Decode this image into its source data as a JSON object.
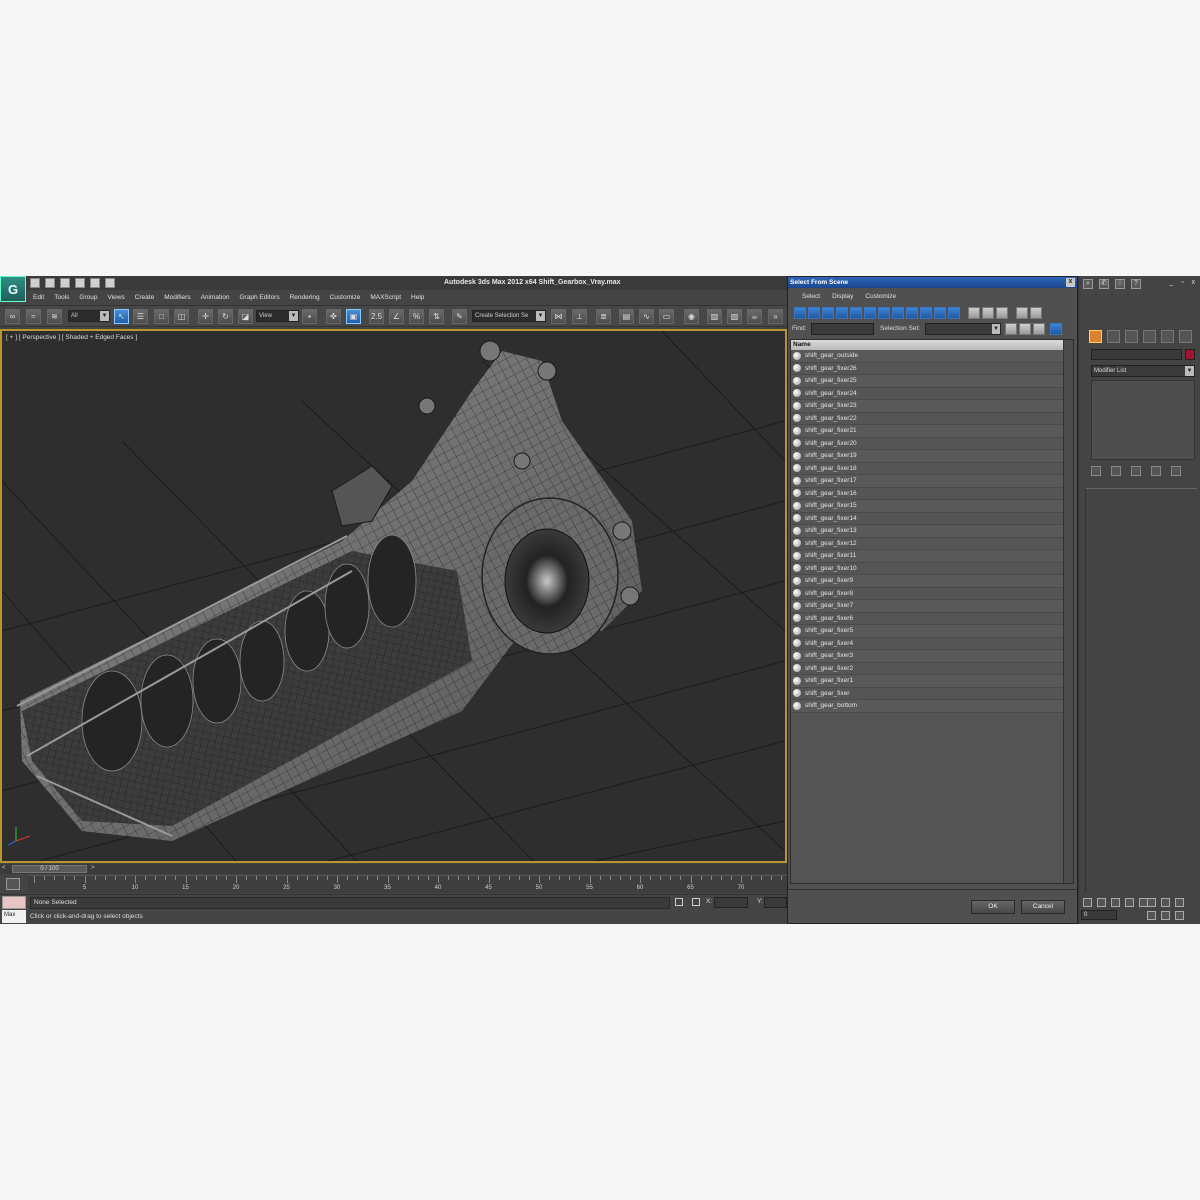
{
  "app": {
    "title": "Autodesk 3ds Max  2012 x64     Shift_Gearbox_Vray.max",
    "logo_glyph": "G"
  },
  "menu": [
    "Edit",
    "Tools",
    "Group",
    "Views",
    "Create",
    "Modifiers",
    "Animation",
    "Graph Editors",
    "Rendering",
    "Customize",
    "MAXScript",
    "Help"
  ],
  "toolbar": {
    "selection_filter": "All",
    "reference_coord": "View",
    "named_selection": "Create Selection Se",
    "snap_label": "2.5",
    "angle_snap_label": "%"
  },
  "viewport": {
    "label": "[ + ] [ Perspective ] [ Shaded + Edged Faces ]",
    "accent": "#b8962d"
  },
  "timeline": {
    "position": "0 / 100",
    "prev": "<",
    "next": ">",
    "ticks": [
      5,
      10,
      15,
      20,
      25,
      30,
      35,
      40,
      45,
      50,
      55,
      60,
      65,
      70
    ]
  },
  "status": {
    "selection": "None Selected",
    "prompt": "Click or click-and-drag to select objects",
    "maxscript": "Max",
    "x_label": "X:",
    "y_label": "Y:"
  },
  "dialog": {
    "title": "Select From Scene",
    "close": "x",
    "menu": [
      "Select",
      "Display",
      "Customize"
    ],
    "find_label": "Find:",
    "selection_set_label": "Selection Set:",
    "column_name": "Name",
    "items": [
      "shift_gear_outside",
      "shift_gear_fixer26",
      "shift_gear_fixer25",
      "shift_gear_fixer24",
      "shift_gear_fixer23",
      "shift_gear_fixer22",
      "shift_gear_fixer21",
      "shift_gear_fixer20",
      "shift_gear_fixer19",
      "shift_gear_fixer18",
      "shift_gear_fixer17",
      "shift_gear_fixer16",
      "shift_gear_fixer15",
      "shift_gear_fixer14",
      "shift_gear_fixer13",
      "shift_gear_fixer12",
      "shift_gear_fixer11",
      "shift_gear_fixer10",
      "shift_gear_fixer9",
      "shift_gear_fixer8",
      "shift_gear_fixer7",
      "shift_gear_fixer6",
      "shift_gear_fixer5",
      "shift_gear_fixer4",
      "shift_gear_fixer3",
      "shift_gear_fixer2",
      "shift_gear_fixer1",
      "shift_gear_fixer",
      "shift_gear_bottom"
    ],
    "ok_label": "OK",
    "cancel_label": "Cancel"
  },
  "command_panel": {
    "modifier_list": "Modifier List",
    "object_color": "#a0152e",
    "frame_value": "0",
    "help_glyph": "?",
    "window_controls": "_ ▫ x"
  }
}
